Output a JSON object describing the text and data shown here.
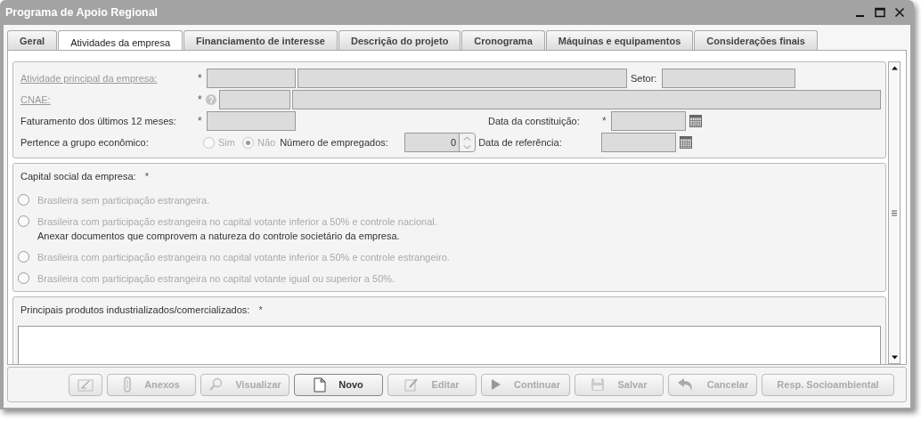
{
  "window": {
    "title": "Programa de Apoio Regional"
  },
  "tabs": [
    {
      "label": "Geral",
      "selected": false
    },
    {
      "label": "Atividades da empresa",
      "selected": true
    },
    {
      "label": "Financiamento de interesse",
      "selected": false
    },
    {
      "label": "Descrição do projeto",
      "selected": false
    },
    {
      "label": "Cronograma",
      "selected": false
    },
    {
      "label": "Máquinas e equipamentos",
      "selected": false
    },
    {
      "label": "Considerações finais",
      "selected": false
    }
  ],
  "company": {
    "activity_label": "Atividade principal da empresa:",
    "activity_required": "*",
    "sector_label": "Setor:",
    "cnae_label": "CNAE:",
    "cnae_required": "*",
    "revenue_label": "Faturamento dos últimos 12 meses:",
    "revenue_required": "*",
    "founded_label": "Data da constituição:",
    "founded_required": "*",
    "group_label": "Pertence a grupo econômico:",
    "group_options": [
      {
        "label": "Sim",
        "selected": false
      },
      {
        "label": "Não",
        "selected": true
      }
    ],
    "group_disabled": true,
    "employees_label": "Número de empregados:",
    "employees_value": "0",
    "reference_label": "Data de referência:"
  },
  "capital": {
    "label": "Capital social da empresa:",
    "required": "*",
    "options": [
      {
        "label": "Brasileira sem participação estrangeira.",
        "selected": false
      },
      {
        "label": "Brasileira com participação estrangeira no capital votante inferior a 50% e controle nacional.",
        "selected": false,
        "note": "Anexar documentos que comprovem a natureza do controle societário da empresa."
      },
      {
        "label": "Brasileira com participação estrangeira no capital votante inferior a 50% e controle estrangeiro.",
        "selected": false
      },
      {
        "label": "Brasileira com participação estrangeira no capital votante igual ou superior a 50%.",
        "selected": false
      }
    ]
  },
  "products": {
    "label": "Principais produtos industrializados/comercializados:",
    "required": "*"
  },
  "buttons": [
    {
      "kind": "sign",
      "disabled": true
    },
    {
      "kind": "attach",
      "label": "Anexos",
      "disabled": true
    },
    {
      "kind": "view",
      "label": "Visualizar",
      "disabled": true
    },
    {
      "kind": "new",
      "label": "Novo",
      "disabled": false
    },
    {
      "kind": "edit",
      "label": "Editar",
      "disabled": true
    },
    {
      "kind": "continue",
      "label": "Continuar",
      "disabled": true
    },
    {
      "kind": "save",
      "label": "Salvar",
      "disabled": true
    },
    {
      "kind": "cancel",
      "label": "Cancelar",
      "disabled": true
    },
    {
      "kind": "text",
      "label": "Resp. Socioambiental",
      "disabled": true
    }
  ]
}
